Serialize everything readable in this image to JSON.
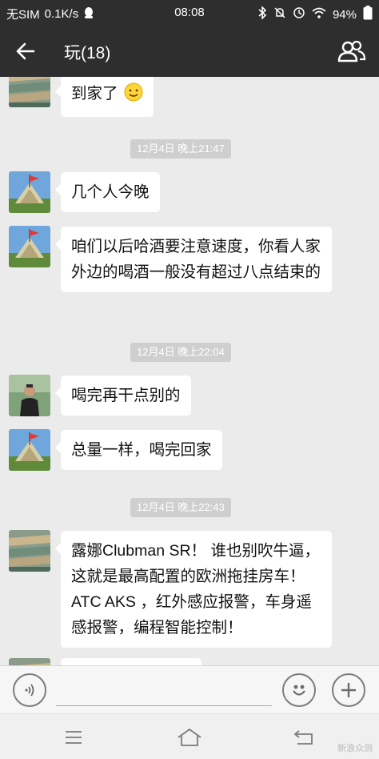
{
  "status_bar": {
    "carrier": "无SIM",
    "speed": "0.1K/s",
    "time": "08:08",
    "battery": "94%"
  },
  "header": {
    "back_icon": "back-arrow-icon",
    "title": "玩(18)",
    "group_icon": "group-members-icon"
  },
  "messages": [
    {
      "type": "text",
      "text": "到家了",
      "avatar": "avatar-rock-wall",
      "emoji": "smile-emoji"
    },
    {
      "type": "time",
      "text": "12月4日 晚上21:47"
    },
    {
      "type": "text",
      "text": "几个人今晚",
      "avatar": "avatar-flag-pyramid"
    },
    {
      "type": "text",
      "text": "咱们以后哈酒要注意速度，你看人家外边的喝酒一般没有超过八点结束的",
      "avatar": "avatar-flag-pyramid"
    },
    {
      "type": "time",
      "text": "12月4日 晚上22:04"
    },
    {
      "type": "text",
      "text": "喝完再干点别的",
      "avatar": "avatar-person"
    },
    {
      "type": "text",
      "text": "总量一样，喝完回家",
      "avatar": "avatar-flag-pyramid"
    },
    {
      "type": "time",
      "text": "12月4日 晚上22:43"
    },
    {
      "type": "text",
      "text": "露娜Clubman SR！ 谁也别吹牛逼，这就是最高配置的欧洲拖挂房车！ATC AKS ，红外感应报警，车身遥感报警，编程智能控制！",
      "avatar": "avatar-rock-wall"
    }
  ],
  "input_bar": {
    "voice_icon": "voice-icon",
    "emoji_icon": "emoji-icon",
    "plus_icon": "plus-icon"
  },
  "nav_bar": {
    "menu_icon": "menu-icon",
    "home_icon": "home-icon",
    "back_icon": "nav-back-icon"
  },
  "watermark": "新浪众测"
}
